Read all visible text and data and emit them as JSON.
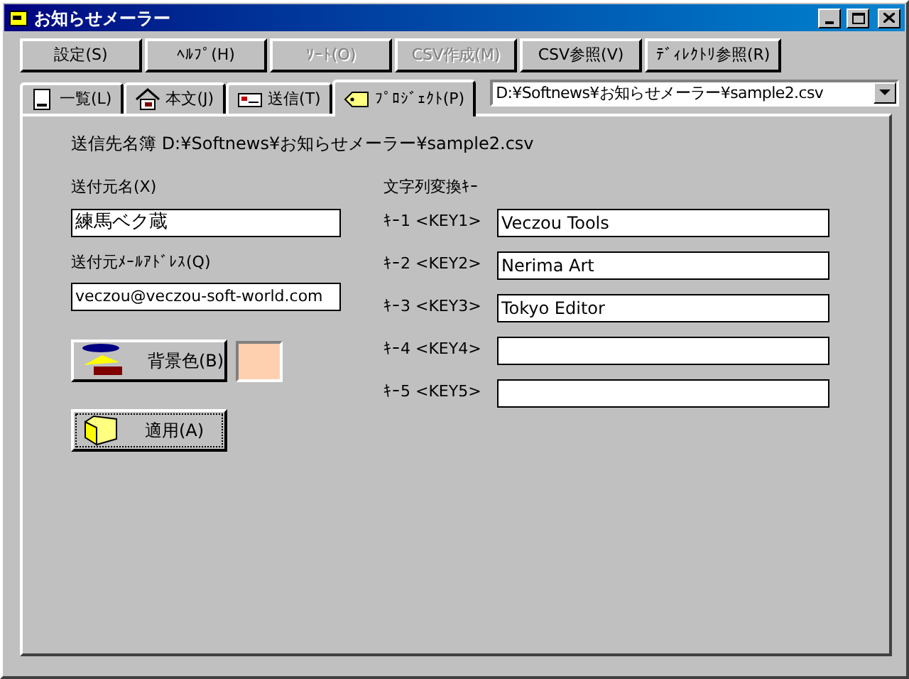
{
  "window": {
    "title": "お知らせメーラー"
  },
  "toolbar": [
    {
      "label": "設定(S)",
      "disabled": false
    },
    {
      "label": "ﾍﾙﾌﾟ(H)",
      "disabled": false
    },
    {
      "label": "ｿｰﾄ(O)",
      "disabled": true
    },
    {
      "label": "CSV作成(M)",
      "disabled": true
    },
    {
      "label": "CSV参照(V)",
      "disabled": false
    },
    {
      "label": "ﾃﾞｨﾚｸﾄﾘ参照(R)",
      "disabled": false
    }
  ],
  "tabs": [
    {
      "label": "一覧(L)",
      "selected": false,
      "kind": "list"
    },
    {
      "label": "本文(J)",
      "selected": false,
      "kind": "body"
    },
    {
      "label": "送信(T)",
      "selected": false,
      "kind": "send"
    },
    {
      "label": "ﾌﾟﾛｼﾞｪｸﾄ(P)",
      "selected": true,
      "kind": "project"
    }
  ],
  "file_combo": {
    "value": "D:¥Softnews¥お知らせメーラー¥sample2.csv"
  },
  "project": {
    "address_book": "送信先名簿 D:¥Softnews¥お知らせメーラー¥sample2.csv",
    "sender_name": {
      "label": "送付元名(X)",
      "value": "練馬ベク蔵"
    },
    "sender_email": {
      "label": "送付元ﾒｰﾙｱﾄﾞﾚｽ(Q)",
      "value": "veczou@veczou-soft-world.com"
    },
    "background_button": "背景色(B)",
    "background_swatch": {
      "color": "#ffd0b0"
    },
    "apply_button": "適用(A)",
    "keys_heading": "文字列変換ｷｰ",
    "keys": [
      {
        "label": "ｷｰ1 <KEY1>",
        "value": "Veczou Tools"
      },
      {
        "label": "ｷｰ2 <KEY2>",
        "value": "Nerima Art"
      },
      {
        "label": "ｷｰ3 <KEY3>",
        "value": "Tokyo Editor"
      },
      {
        "label": "ｷｰ4 <KEY4>"
      },
      {
        "label": "ｷｰ5 <KEY5>"
      }
    ]
  }
}
